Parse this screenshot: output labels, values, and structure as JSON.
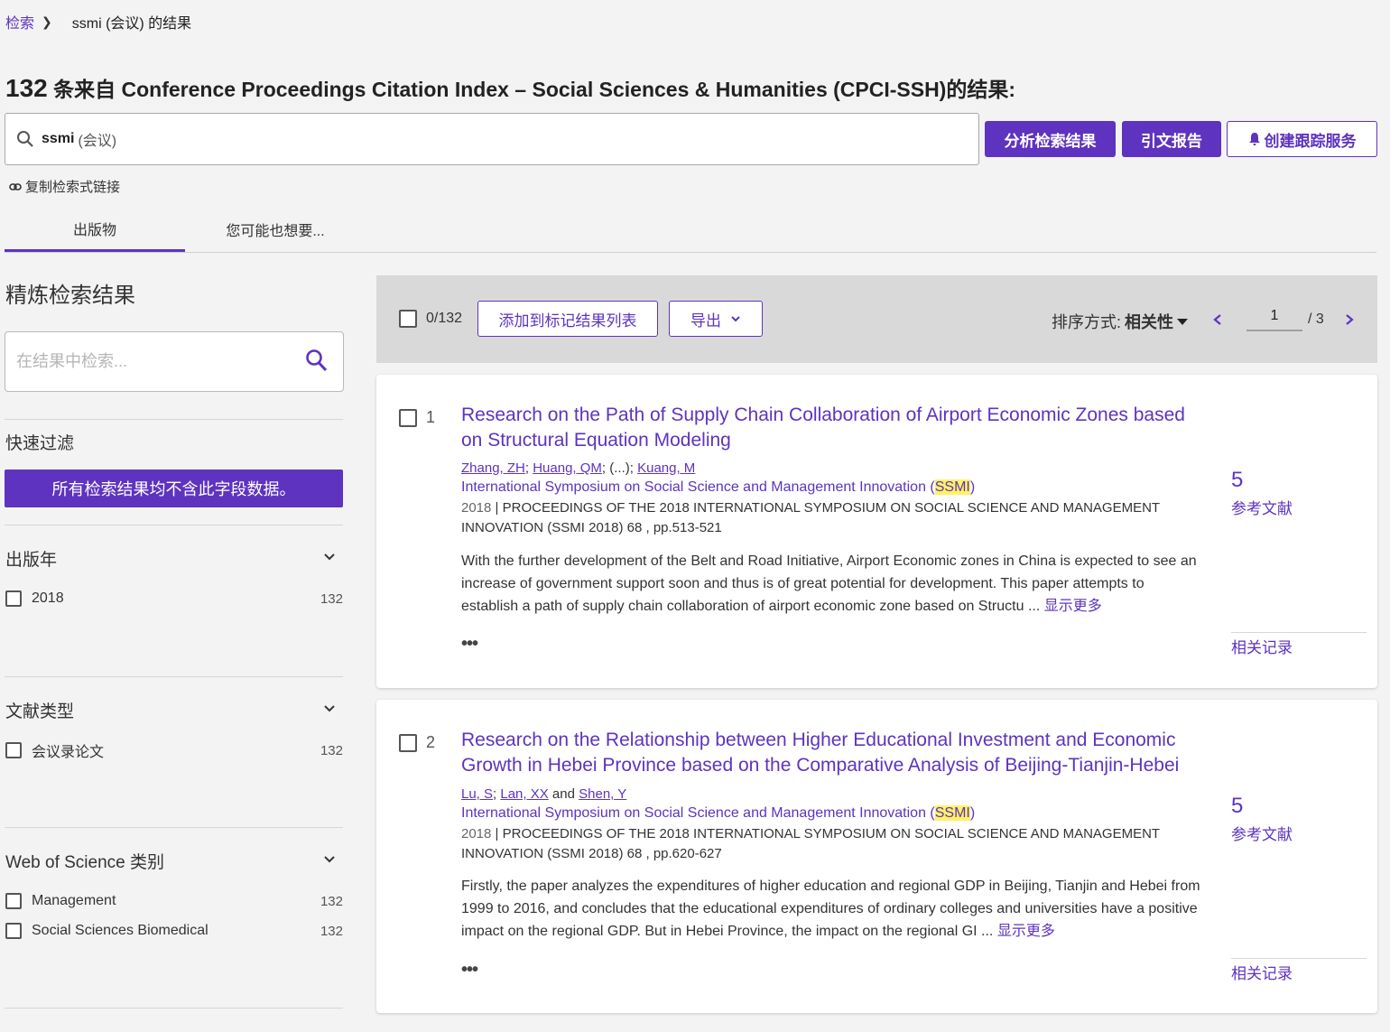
{
  "breadcrumb": {
    "root": "检索",
    "current": "ssmi (会议) 的结果"
  },
  "header": {
    "count": "132",
    "title_rest": " 条来自 Conference Proceedings Citation Index – Social Sciences & Humanities (CPCI-SSH)的结果:"
  },
  "search": {
    "term": "ssmi",
    "field": "(会议)"
  },
  "actions": {
    "analyze": "分析检索结果",
    "citation_report": "引文报告",
    "create_alert": "创建跟踪服务"
  },
  "copy_link": "复制检索式链接",
  "tabs": [
    {
      "label": "出版物"
    },
    {
      "label": "您可能也想要..."
    }
  ],
  "sidebar": {
    "refine_title": "精炼检索结果",
    "refine_placeholder": "在结果中检索...",
    "quick_filter": {
      "title": "快速过滤",
      "message": "所有检索结果均不含此字段数据。"
    },
    "facets": [
      {
        "title": "出版年",
        "options": [
          {
            "label": "2018",
            "count": "132"
          }
        ]
      },
      {
        "title": "文献类型",
        "options": [
          {
            "label": "会议录论文",
            "count": "132"
          }
        ]
      },
      {
        "title": "Web of Science 类别",
        "options": [
          {
            "label": "Management",
            "count": "132"
          },
          {
            "label": "Social Sciences Biomedical",
            "count": "132"
          }
        ]
      }
    ]
  },
  "toolbar": {
    "selected": "0/132",
    "add_to_marked": "添加到标记结果列表",
    "export": "导出",
    "sort_label": "排序方式:",
    "sort_value": "相关性",
    "page": "1",
    "total_pages": "/ 3"
  },
  "results": [
    {
      "index": "1",
      "title": "Research on the Path of Supply Chain Collaboration of Airport Economic Zones based on Structural Equation Modeling",
      "authors": [
        "Zhang, ZH",
        "Huang, QM",
        "Kuang, M"
      ],
      "authors_sep_1": "; ",
      "authors_mid": "; (...); ",
      "conference": "International Symposium on Social Science and Management Innovation (",
      "conference_hl": "SSMI",
      "conference_end": ")",
      "year": "2018",
      "source": " | PROCEEDINGS OF THE 2018 INTERNATIONAL SYMPOSIUM ON SOCIAL SCIENCE AND MANAGEMENT INNOVATION (SSMI 2018) 68 , pp.513-521",
      "abstract": "With the further development of the Belt and Road Initiative, Airport Economic zones in China is expected to see an increase of government support soon and thus is of great potential for development. This paper attempts to establish a path of supply chain collaboration of airport economic zone based on Structu ...",
      "show_more": "显示更多",
      "references_count": "5",
      "references_label": "参考文献",
      "related": "相关记录",
      "more": "•••"
    },
    {
      "index": "2",
      "title": "Research on the Relationship between Higher Educational Investment and Economic Growth in Hebei Province based on the Comparative Analysis of Beijing-Tianjin-Hebei",
      "authors": [
        "Lu, S",
        "Lan, XX",
        "Shen, Y"
      ],
      "authors_sep_1": "; ",
      "authors_mid": " and ",
      "conference": "International Symposium on Social Science and Management Innovation (",
      "conference_hl": "SSMI",
      "conference_end": ")",
      "year": "2018",
      "source": " | PROCEEDINGS OF THE 2018 INTERNATIONAL SYMPOSIUM ON SOCIAL SCIENCE AND MANAGEMENT INNOVATION (SSMI 2018) 68 , pp.620-627",
      "abstract": "Firstly, the paper analyzes the expenditures of higher education and regional GDP in Beijing, Tianjin and Hebei from 1999 to 2016, and concludes that the educational expenditures of ordinary colleges and universities have a positive impact on the regional GDP. But in Hebei Province, the impact on the regional GI ...",
      "show_more": "显示更多",
      "references_count": "5",
      "references_label": "参考文献",
      "related": "相关记录",
      "more": "•••"
    }
  ],
  "colors": {
    "accent": "#5e33bf",
    "highlight": "#fff263",
    "toolbar_bg": "#d9d9d9",
    "page_bg": "#f3f3f3"
  },
  "icons": {
    "search": "search-icon",
    "link": "link-icon",
    "bell": "bell-icon",
    "chevron": "chevron-down-icon"
  }
}
